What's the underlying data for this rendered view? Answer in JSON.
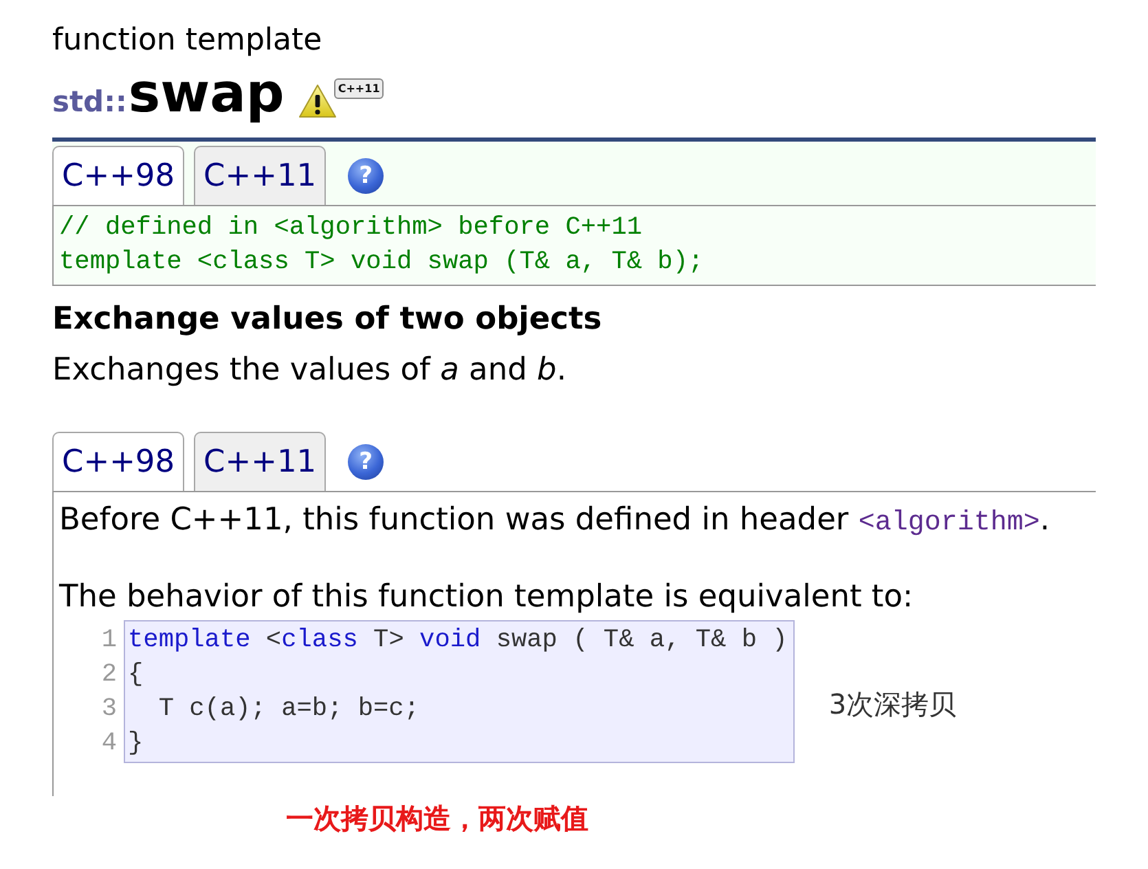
{
  "header": {
    "kicker": "function template",
    "namespace": "std::",
    "name": "swap",
    "badge": "C++11"
  },
  "declaration": {
    "tabs": [
      {
        "label": "C++98",
        "selected": true
      },
      {
        "label": "C++11",
        "selected": false
      }
    ],
    "help": "?",
    "lines": [
      "// defined in <algorithm> before C++11",
      "template <class T> void swap (T& a, T& b);"
    ]
  },
  "summary": {
    "heading": "Exchange values of two objects",
    "text": "Exchanges the values of *a* and *b*."
  },
  "description": {
    "tabs": [
      {
        "label": "C++98",
        "selected": true
      },
      {
        "label": "C++11",
        "selected": false
      }
    ],
    "help": "?",
    "intro": {
      "text": "Before C++11, this function was defined in header ",
      "link": "<algorithm>",
      "end": "."
    },
    "lead": "The behavior of this function template is equivalent to:",
    "code": [
      {
        "number": "1",
        "tokens": [
          {
            "kind": "keyword",
            "text": "template"
          },
          {
            "kind": "plain",
            "text": " <"
          },
          {
            "kind": "keyword",
            "text": "class"
          },
          {
            "kind": "plain",
            "text": " T> "
          },
          {
            "kind": "keyword",
            "text": "void"
          },
          {
            "kind": "plain",
            "text": " swap ( T& a, T& b )"
          }
        ]
      },
      {
        "number": "2",
        "tokens": [
          {
            "kind": "plain",
            "text": "{"
          }
        ]
      },
      {
        "number": "3",
        "tokens": [
          {
            "kind": "plain",
            "text": "  T c(a); a=b; b=c;"
          }
        ]
      },
      {
        "number": "4",
        "tokens": [
          {
            "kind": "plain",
            "text": "}"
          }
        ]
      }
    ]
  },
  "notes": {
    "side": "3次深拷贝",
    "bottom": "一次拷贝构造，两次赋值"
  }
}
